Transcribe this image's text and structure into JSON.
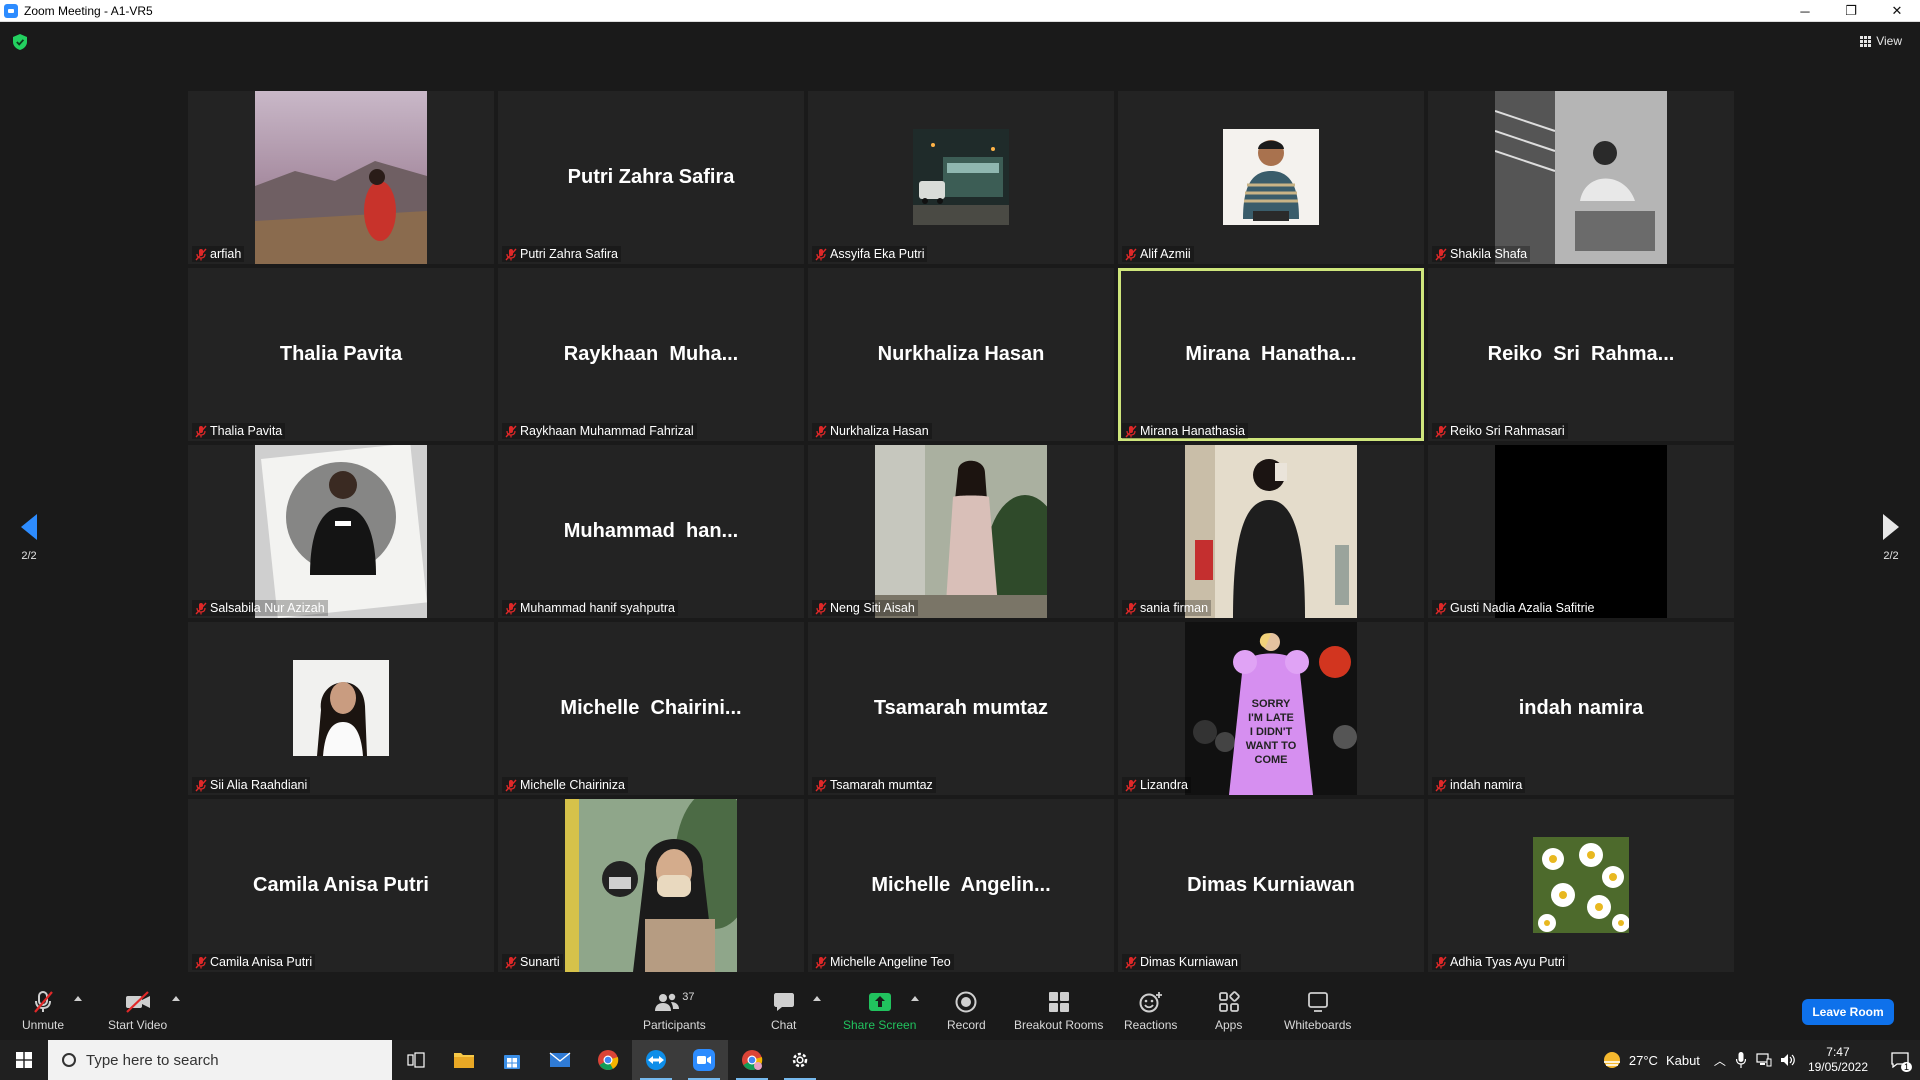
{
  "window": {
    "title": "Zoom Meeting - A1-VR5",
    "minimize": "─",
    "restore": "❐",
    "close": "✕"
  },
  "meeting": {
    "view_label": "View",
    "page_left": "2/2",
    "page_right": "2/2",
    "tiles": [
      {
        "name": "arfiah",
        "big": "",
        "photo": "mountain",
        "active": false
      },
      {
        "name": "Putri Zahra Safira",
        "big": "Putri Zahra Safira",
        "photo": "",
        "active": false
      },
      {
        "name": "Assyifa Eka Putri",
        "big": "",
        "photo": "street",
        "active": false
      },
      {
        "name": "Alif Azmii",
        "big": "",
        "photo": "man",
        "active": false
      },
      {
        "name": "Shakila Shafa",
        "big": "",
        "photo": "bw",
        "active": false
      },
      {
        "name": "Thalia Pavita",
        "big": "Thalia Pavita",
        "photo": "",
        "active": false
      },
      {
        "name": "Raykhaan Muhammad Fahrizal",
        "big": "Raykhaan  Muha...",
        "photo": "",
        "active": false
      },
      {
        "name": "Nurkhaliza Hasan",
        "big": "Nurkhaliza Hasan",
        "photo": "",
        "active": false
      },
      {
        "name": "Mirana Hanathasia",
        "big": "Mirana  Hanatha...",
        "photo": "",
        "active": true
      },
      {
        "name": "Reiko Sri Rahmasari",
        "big": "Reiko  Sri  Rahma...",
        "photo": "",
        "active": false
      },
      {
        "name": "Salsabila Nur Azizah",
        "big": "",
        "photo": "polaroid",
        "active": false
      },
      {
        "name": "Muhammad hanif syahputra",
        "big": "Muhammad  han...",
        "photo": "",
        "active": false
      },
      {
        "name": "Neng Siti Aisah",
        "big": "",
        "photo": "dress",
        "active": false
      },
      {
        "name": "sania firman",
        "big": "",
        "photo": "mirror",
        "active": false
      },
      {
        "name": "Gusti Nadia Azalia Safitrie",
        "big": "",
        "photo": "black",
        "active": false
      },
      {
        "name": "Sii Alia Raahdiani",
        "big": "",
        "photo": "portrait",
        "active": false
      },
      {
        "name": "Michelle Chairiniza",
        "big": "Michelle  Chairini...",
        "photo": "",
        "active": false
      },
      {
        "name": "Tsamarah mumtaz",
        "big": "Tsamarah mumtaz",
        "photo": "",
        "active": false
      },
      {
        "name": "Lizandra",
        "big": "",
        "photo": "runway",
        "active": false
      },
      {
        "name": "indah namira",
        "big": "indah namira",
        "photo": "",
        "active": false
      },
      {
        "name": "Camila Anisa Putri",
        "big": "Camila Anisa Putri",
        "photo": "",
        "active": false
      },
      {
        "name": "Sunarti",
        "big": "",
        "photo": "selfie",
        "active": false
      },
      {
        "name": "Michelle Angeline Teo",
        "big": "Michelle  Angelin...",
        "photo": "",
        "active": false
      },
      {
        "name": "Dimas Kurniawan",
        "big": "Dimas Kurniawan",
        "photo": "",
        "active": false
      },
      {
        "name": "Adhia Tyas Ayu Putri",
        "big": "",
        "photo": "daisies",
        "active": false
      }
    ]
  },
  "toolbar": {
    "unmute": "Unmute",
    "start_video": "Start Video",
    "participants": "Participants",
    "participant_count": "37",
    "chat": "Chat",
    "share_screen": "Share Screen",
    "record": "Record",
    "breakout_rooms": "Breakout Rooms",
    "reactions": "Reactions",
    "apps": "Apps",
    "whiteboards": "Whiteboards",
    "leave": "Leave Room"
  },
  "taskbar": {
    "search_placeholder": "Type here to search",
    "weather_temp": "27°C",
    "weather_desc": "Kabut",
    "time": "7:47",
    "date": "19/05/2022",
    "notification_count": "1"
  },
  "colors": {
    "accent": "#2D8CFF",
    "active_speaker": "#cfe67c",
    "share_green": "#21c25e",
    "leave_blue": "#0E71EB",
    "muted_red": "#e02828"
  }
}
